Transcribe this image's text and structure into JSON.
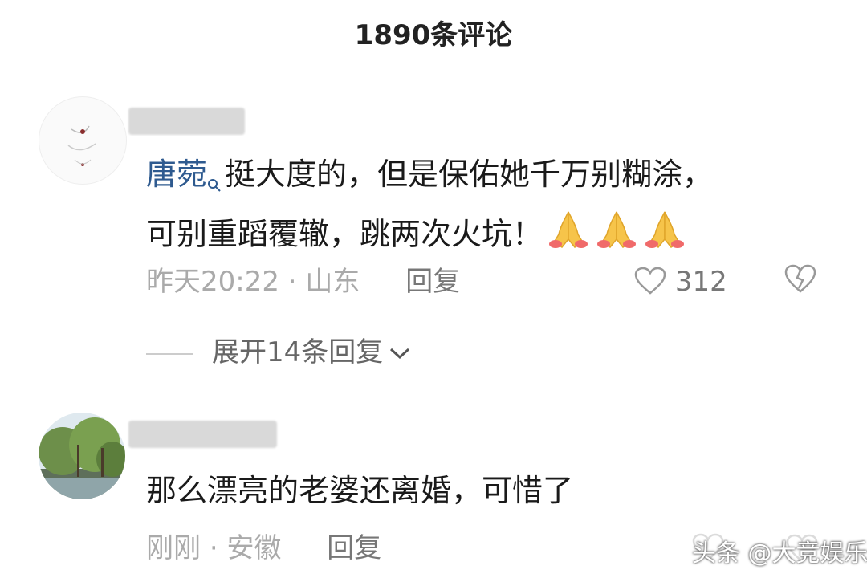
{
  "header": {
    "title": "1890条评论"
  },
  "comments": [
    {
      "mention": "唐菀",
      "text_line1": "挺大度的，但是保佑她千万别糊涂，",
      "text_line2": "可别重蹈覆辙，跳两次火坑！",
      "time": "昨天20:22",
      "separator": "·",
      "location": "山东",
      "reply_label": "回复",
      "like_count": "312",
      "emoji_count": 3,
      "icons": {
        "like": "heart-icon",
        "dislike": "broken-heart-icon",
        "emoji": "praying-hands-icon"
      }
    },
    {
      "text": "那么漂亮的老婆还离婚，可惜了",
      "time": "刚刚",
      "separator": "·",
      "location": "安徽",
      "reply_label": "回复"
    }
  ],
  "expand": {
    "label": "展开14条回复"
  },
  "watermark": "头条 @大竞娱乐"
}
